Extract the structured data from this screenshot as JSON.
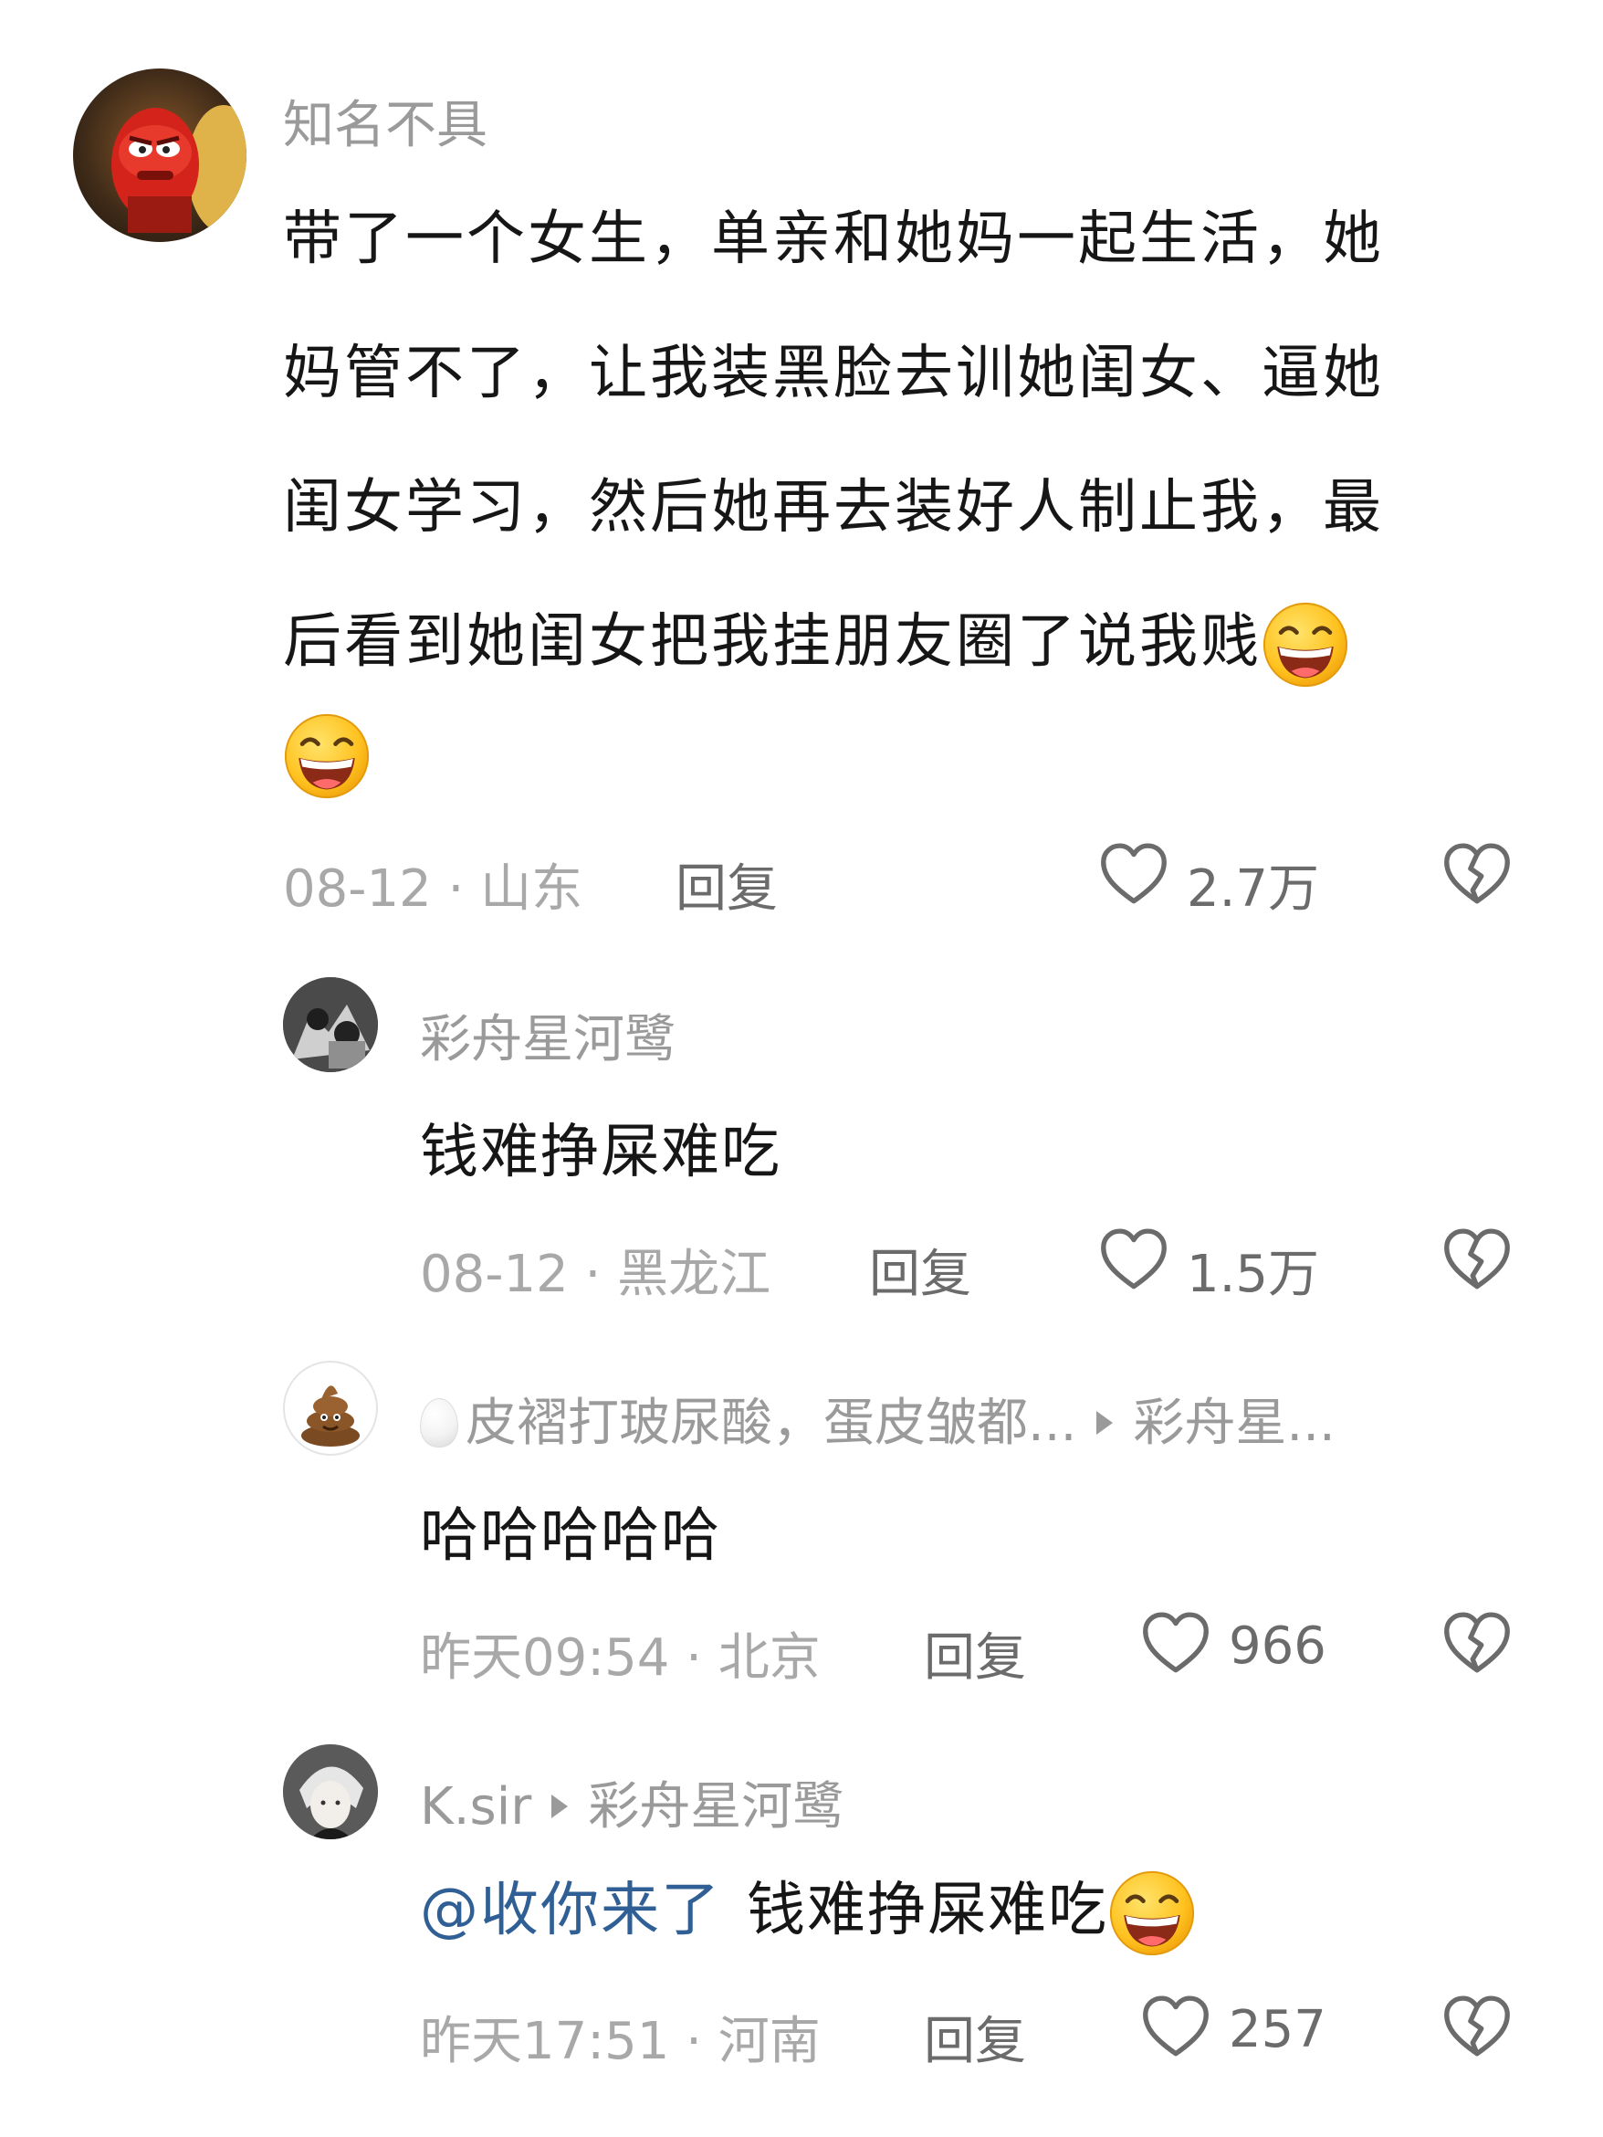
{
  "comments": [
    {
      "username": "知名不具",
      "content_lines": [
        "带了一个女生，单亲和她妈一起生活，她",
        "妈管不了，让我装黑脸去训她闺女、逼她",
        "闺女学习，然后她再去装好人制止我，最",
        "后看到她闺女把我挂朋友圈了说我贱"
      ],
      "meta": "08-12 · 山东",
      "reply_label": "回复",
      "likes": "2.7万"
    },
    {
      "username": "彩舟星河鹭",
      "content": "钱难挣屎难吃",
      "meta": "08-12 · 黑龙江",
      "reply_label": "回复",
      "likes": "1.5万"
    },
    {
      "username": "皮褶打玻尿酸，蛋皮皱都...",
      "reply_to": "彩舟星...",
      "content": "哈哈哈哈哈",
      "meta": "昨天09:54 · 北京",
      "reply_label": "回复",
      "likes": "966"
    },
    {
      "username": "K.sir",
      "reply_to": "彩舟星河鹭",
      "mention": "@收你来了",
      "content": "钱难挣屎难吃",
      "meta": "昨天17:51 · 河南",
      "reply_label": "回复",
      "likes": "257"
    }
  ],
  "icons": {
    "like": "heart-outline-icon",
    "dislike": "broken-heart-icon",
    "emoji": "grinning-face-emoji",
    "reply_arrow": "triangle-right-icon",
    "egg": "egg-emoji"
  },
  "colors": {
    "username": "#9a9a9a",
    "content": "#161616",
    "meta": "#a8a8a8",
    "mention": "#2f5f94"
  }
}
